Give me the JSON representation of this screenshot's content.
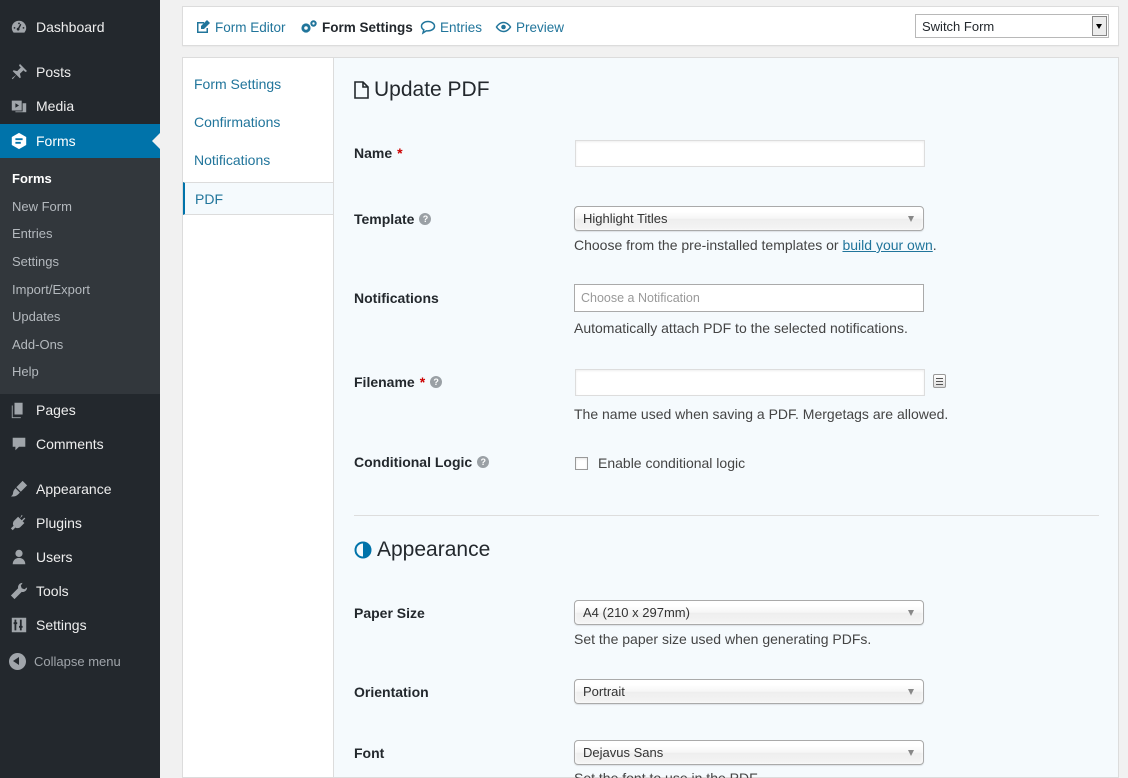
{
  "sidebar": {
    "items": [
      {
        "label": "Dashboard",
        "icon": "dashboard-icon"
      },
      {
        "label": "Posts",
        "icon": "pin-icon"
      },
      {
        "label": "Media",
        "icon": "media-icon"
      },
      {
        "label": "Forms",
        "icon": "forms-icon"
      },
      {
        "label": "Pages",
        "icon": "pages-icon"
      },
      {
        "label": "Comments",
        "icon": "comments-icon"
      },
      {
        "label": "Appearance",
        "icon": "brush-icon"
      },
      {
        "label": "Plugins",
        "icon": "plug-icon"
      },
      {
        "label": "Users",
        "icon": "user-icon"
      },
      {
        "label": "Tools",
        "icon": "wrench-icon"
      },
      {
        "label": "Settings",
        "icon": "sliders-icon"
      }
    ],
    "submenu": [
      "Forms",
      "New Form",
      "Entries",
      "Settings",
      "Import/Export",
      "Updates",
      "Add-Ons",
      "Help"
    ],
    "collapse_label": "Collapse menu"
  },
  "toolbar": {
    "form_editor": "Form Editor",
    "form_settings": "Form Settings",
    "entries": "Entries",
    "preview": "Preview",
    "switch_form": "Switch Form"
  },
  "settings_nav": [
    "Form Settings",
    "Confirmations",
    "Notifications",
    "PDF"
  ],
  "panel": {
    "title": "Update PDF",
    "name_label": "Name",
    "name_value": "",
    "template_label": "Template",
    "template_value": "Highlight Titles",
    "template_desc": "Choose from the pre-installed templates or ",
    "template_link": "build your own",
    "template_desc_end": ".",
    "notifications_label": "Notifications",
    "notifications_placeholder": "Choose a Notification",
    "notifications_desc": "Automatically attach PDF to the selected notifications.",
    "filename_label": "Filename",
    "filename_value": "",
    "filename_desc": "The name used when saving a PDF. Mergetags are allowed.",
    "conditional_label": "Conditional Logic",
    "conditional_checkbox": "Enable conditional logic",
    "required_mark": "*",
    "help_mark": "?",
    "appearance_title": "Appearance",
    "paper_label": "Paper Size",
    "paper_value": "A4 (210 x 297mm)",
    "paper_desc": "Set the paper size used when generating PDFs.",
    "orientation_label": "Orientation",
    "orientation_value": "Portrait",
    "font_label": "Font",
    "font_value": "Dejavus Sans",
    "font_desc": "Set the font to use in the PDF."
  },
  "colors": {
    "admin_bar": "#23282d",
    "submenu_bg": "#32373c",
    "accent": "#0073aa",
    "link": "#21759b",
    "required": "#cc0000"
  }
}
